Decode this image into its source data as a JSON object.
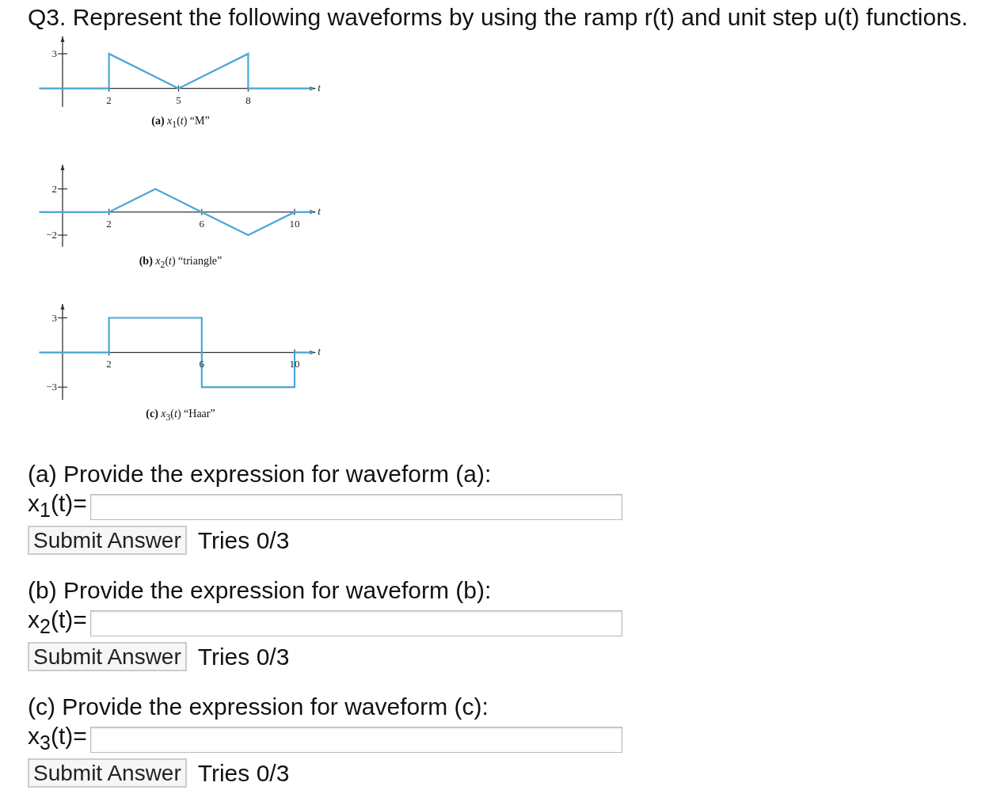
{
  "question": {
    "title": "Q3. Represent the following waveforms by using the ramp r(t) and unit step u(t) functions."
  },
  "figures": [
    {
      "picture": {
        "caption": "**(a)** *x*$_{1}$(*t*) “M”",
        "axis_label": "t",
        "x_tick_labels": [
          "2",
          "5",
          "8"
        ],
        "y_tick_labels": [
          "3"
        ]
      }
    },
    {
      "chart_data": {
        "type": "line",
        "title": "**(b)** *x*$_{2}$(*t*) “triangle”",
        "xlabel": "t",
        "x": [
          -1,
          2,
          4,
          6,
          8,
          10,
          10.8
        ],
        "series": [
          {
            "color": "#4aa8d8",
            "values": [
              0,
              0,
              2,
              0,
              -2,
              0,
              0
            ]
          }
        ],
        "xlim": [
          -1,
          10.9
        ],
        "ylim": [
          -3,
          4.1
        ],
        "xticks": [
          2,
          6,
          10
        ],
        "yticks": [
          -2,
          2
        ]
      }
    },
    {
      "chart_data": {
        "type": "line",
        "title": "**(c)** *x*$_{3}$(*t*) “Haar”",
        "xlabel": "t",
        "x": [
          -1,
          2,
          2,
          6,
          6,
          10,
          10,
          10.8
        ],
        "series": [
          {
            "color": "#4aa8d8",
            "values": [
              0,
              0,
              3,
              3,
              -3,
              -3,
              0,
              0
            ]
          }
        ],
        "xlim": [
          -1,
          10.9
        ],
        "ylim": [
          -4.1,
          4.2
        ],
        "xticks": [
          2,
          6,
          10
        ],
        "yticks": [
          -3,
          3
        ]
      }
    }
  ],
  "parts": [
    {
      "prompt": "(a) Provide the expression for waveform (a):",
      "label": "x$_{1}$(t)=",
      "button": "Submit Answer",
      "tries": "Tries 0/3"
    },
    {
      "prompt": "(b) Provide the expression for waveform (b):",
      "label": "x$_{2}$(t)=",
      "button": "Submit Answer",
      "tries": "Tries 0/3"
    },
    {
      "prompt": "(c) Provide the expression for waveform (c):",
      "label": "x$_{3}$(t)=",
      "button": "Submit Answer",
      "tries": "Tries 0/3"
    }
  ]
}
